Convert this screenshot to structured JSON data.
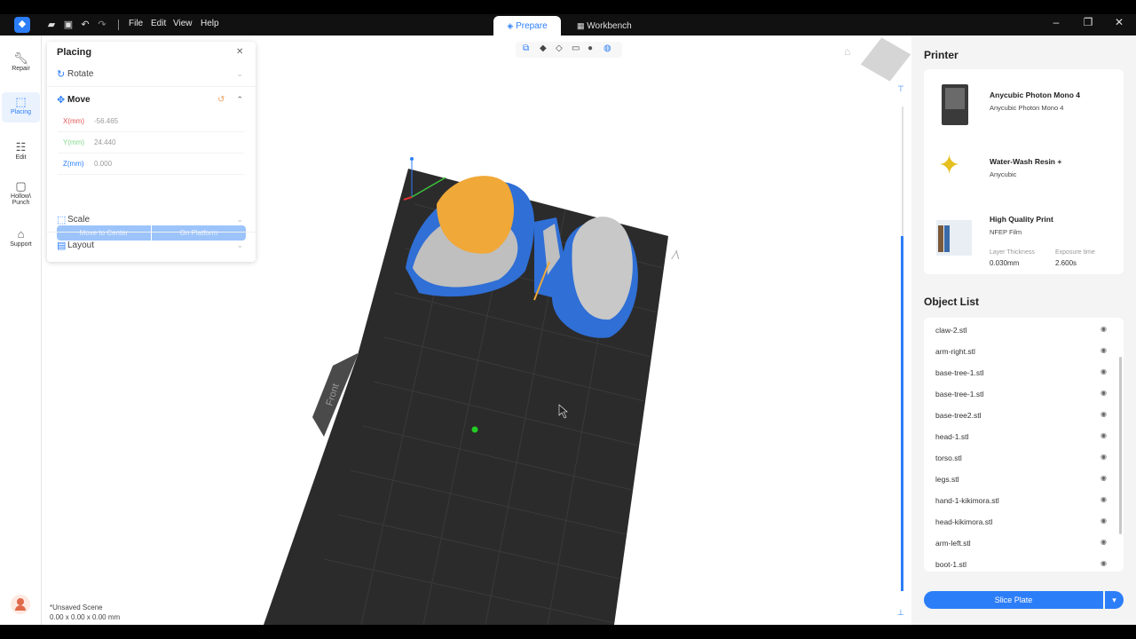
{
  "titlebar": {
    "menu": [
      "File",
      "Edit",
      "View",
      "Help"
    ],
    "tabs": {
      "prepare": "Prepare",
      "workbench": "Workbench"
    }
  },
  "leftbar": {
    "items": [
      "Repair",
      "Placing",
      "Edit",
      "Hollow\\ Punch",
      "Support"
    ]
  },
  "placing": {
    "title": "Placing",
    "rotate": "Rotate",
    "move": "Move",
    "x_label": "X(mm)",
    "x_value": "-56.465",
    "y_label": "Y(mm)",
    "y_value": "24.440",
    "z_label": "Z(mm)",
    "z_value": "0.000",
    "move_to_center": "Move to Center",
    "on_platform": "On Platform",
    "scale": "Scale",
    "layout": "Layout"
  },
  "viewport": {
    "front_label": "Front",
    "scene_name": "*Unsaved Scene",
    "scene_dims": "0.00 x 0.00 x 0.00 mm"
  },
  "printer": {
    "title": "Printer",
    "machine_name": "Anycubic Photon Mono 4",
    "machine_sub": "Anycubic Photon Mono 4",
    "resin_name": "Water-Wash Resin +",
    "resin_sub": "Anycubic",
    "profile_name": "High Quality Print",
    "profile_sub": "NFEP Film",
    "layer_label": "Layer Thickness",
    "layer_value": "0.030mm",
    "exposure_label": "Exposure time",
    "exposure_value": "2.600s"
  },
  "object_list": {
    "title": "Object List",
    "items": [
      "claw-2.stl",
      "arm-right.stl",
      "base-tree-1.stl",
      "base-tree-1.stl",
      "base-tree2.stl",
      "head-1.stl",
      "torso.stl",
      "legs.stl",
      "hand-1-kikimora.stl",
      "head-kikimora.stl",
      "arm-left.stl",
      "boot-1.stl"
    ]
  },
  "slice_button": "Slice Plate",
  "colors": {
    "accent": "#2c7ef8",
    "plate": "#2b2b2b",
    "support_blue": "#2f6fd6",
    "selected_orange": "#f0a838",
    "model_gray": "#bfbfbf"
  }
}
